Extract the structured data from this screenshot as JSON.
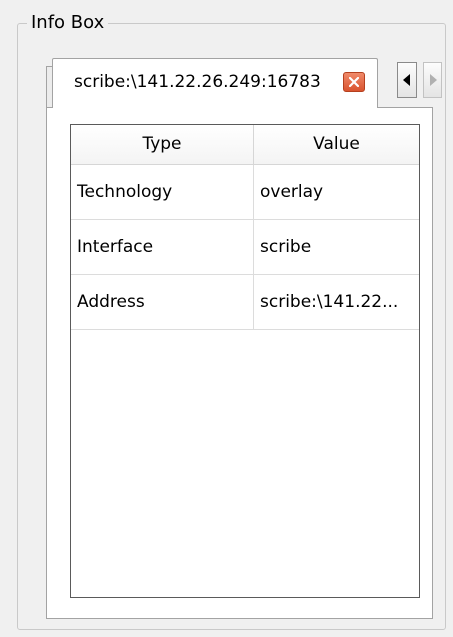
{
  "group_box": {
    "title": "Info Box"
  },
  "tab": {
    "label": "scribe:\\141.22.26.249:16783",
    "close_icon": "close-icon"
  },
  "tab_scroll": {
    "left_icon": "arrow-left-icon",
    "right_icon": "arrow-right-icon"
  },
  "table": {
    "columns": [
      "Type",
      "Value"
    ],
    "rows": [
      [
        "Technology",
        "overlay"
      ],
      [
        "Interface",
        "scribe"
      ],
      [
        "Address",
        "scribe:\\141.22..."
      ]
    ]
  },
  "colors": {
    "close_button": "#d9532f",
    "pane_border": "#a3a3a3",
    "table_border": "#5a5a5a"
  }
}
